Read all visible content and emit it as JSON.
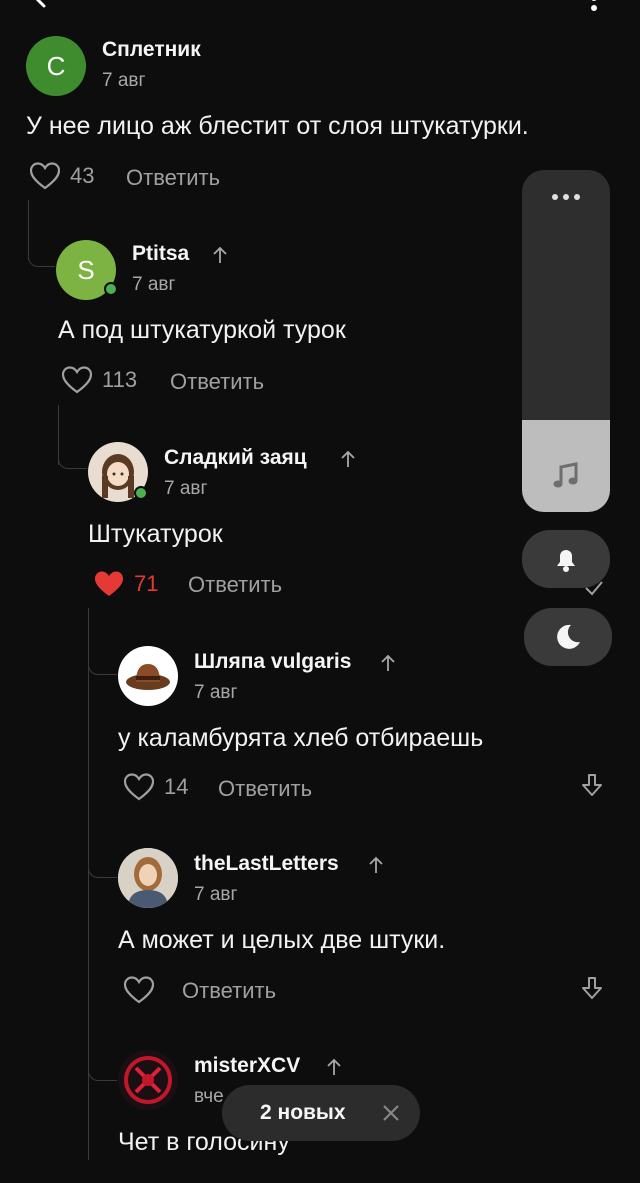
{
  "comments": [
    {
      "author": "Сплетник",
      "initial": "С",
      "date": "7 авг",
      "text": "У нее лицо аж блестит от слоя штукатурки.",
      "likes": "43",
      "reply": "Ответить",
      "avatar_color": "#3f8c2e"
    },
    {
      "author": "Ptitsa",
      "initial": "S",
      "date": "7 авг",
      "text": "А под штукатуркой турок",
      "likes": "113",
      "reply": "Ответить",
      "avatar_color": "#7cb342"
    },
    {
      "author": "Сладкий заяц",
      "date": "7 авг",
      "text": "Штукатурок",
      "likes": "71",
      "reply": "Ответить",
      "liked": true
    },
    {
      "author": "Шляпа vulgaris",
      "date": "7 авг",
      "text": "у каламбурята хлеб отбираешь",
      "likes": "14",
      "reply": "Ответить"
    },
    {
      "author": "theLastLetters",
      "date": "7 авг",
      "text": "А может и целых две штуки.",
      "likes": "",
      "reply": "Ответить"
    },
    {
      "author": "misterXCV",
      "date": "вче",
      "text": "Чет в голосину"
    }
  ],
  "toast": {
    "label": "2 новых"
  },
  "side_panel": {
    "volume_level": 0.27
  },
  "colors": {
    "background": "#0d0d0d",
    "liked_heart": "#e53935",
    "toast": "#2c2c2c"
  }
}
